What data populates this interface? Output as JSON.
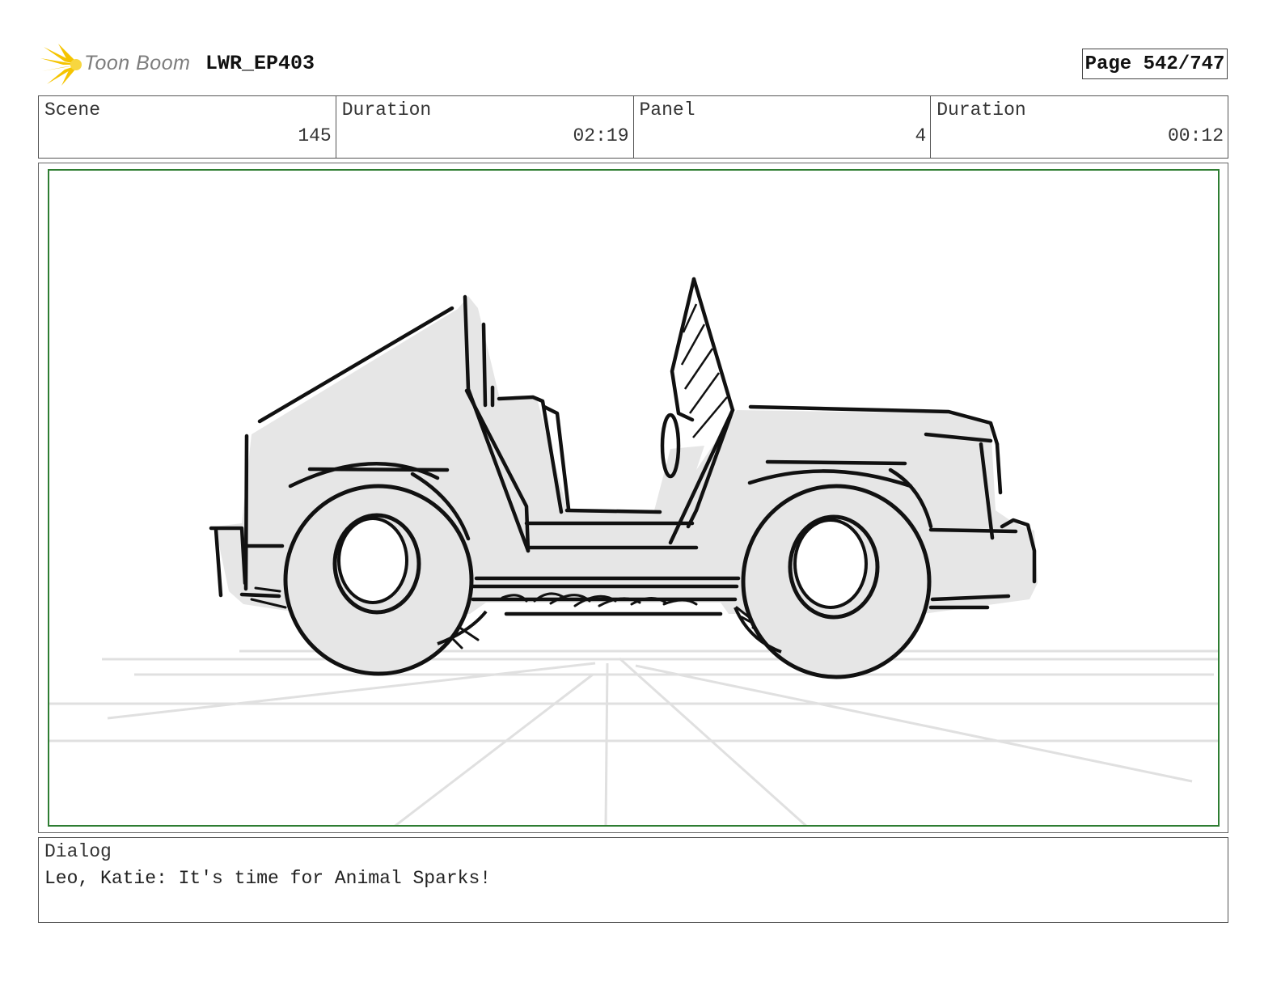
{
  "header": {
    "logo_text": "Toon Boom",
    "project": "LWR_EP403",
    "page": "Page 542/747"
  },
  "info": [
    {
      "label": "Scene",
      "value": "145"
    },
    {
      "label": "Duration",
      "value": "02:19"
    },
    {
      "label": "Panel",
      "value": "4"
    },
    {
      "label": "Duration",
      "value": "00:12"
    }
  ],
  "panel": {
    "subject": "jeep-sketch"
  },
  "dialog": {
    "label": "Dialog",
    "text": "Leo, Katie: It's time for Animal Sparks!"
  },
  "colors": {
    "panel_border": "#2e7d32",
    "logo_accent": "#f5c400",
    "sketch_fill": "#e6e6e6",
    "sketch_line": "#111111",
    "guide_line": "#e0e0e0"
  }
}
